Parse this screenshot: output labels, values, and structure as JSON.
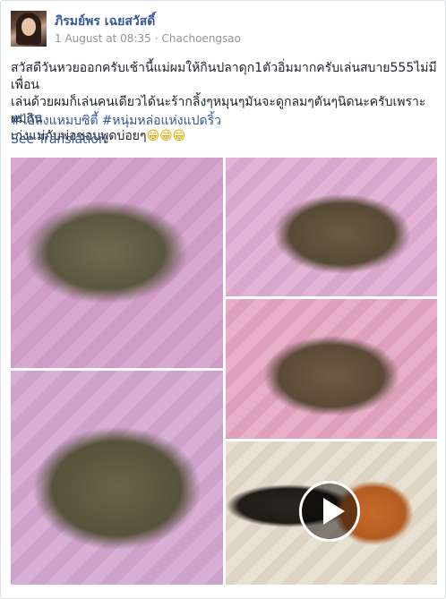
{
  "post": {
    "author": "ภิรมย์พร เฉยสวัสดิ์",
    "date": "1 August at 08:35",
    "separator": "·",
    "location": "Chachoengsao",
    "text_line1": "สวัสดีวันหวยออกครับเช้านี้แม่ผมให้กินปลาดุก1ตัวอิ่มมากครับเล่นสบาย555ไม่มีเพื่อน",
    "text_line2": "เล่นด้วยผมก็เล่นคนเดียวได้นะร้ากลิ้งๆหมุนๆมันจะดูกลมๆตันๆนิดนะครับเพราะผมกิน",
    "text_line3": "เก่งแม่กับพ่อชอบพูดบ่อยๆ",
    "emojis": "😁😁😁",
    "hashtags": [
      "#ไอ้ลิงแหมบซิตี้",
      "#หนุ่มหล่อแห่งแปดริ้ว"
    ],
    "see_translation": "See Translation"
  },
  "media": {
    "photos": [
      {
        "subject": "otter-sleeping-on-pink-blanket"
      },
      {
        "subject": "otter-curled-on-hello-kitty-blanket"
      },
      {
        "subject": "otter-curled-up-asleep"
      },
      {
        "subject": "otter-lying-on-back-paw-raised"
      }
    ],
    "video": {
      "subject": "otter-with-orange-plush-toy",
      "play_icon": "play-icon"
    }
  },
  "colors": {
    "link": "#365899",
    "meta": "#90949c",
    "text": "#1d2129",
    "border": "#dddfe2"
  }
}
